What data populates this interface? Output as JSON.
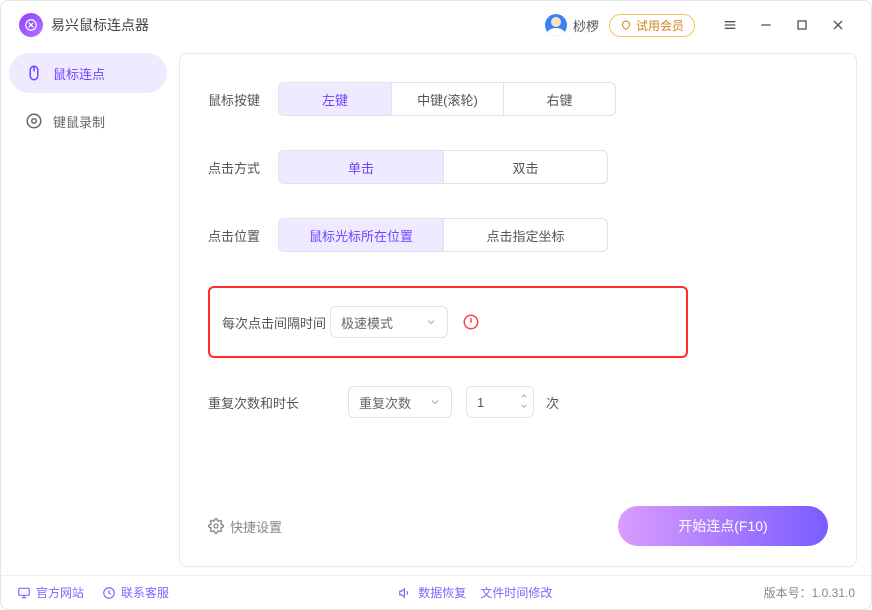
{
  "app": {
    "title": "易兴鼠标连点器"
  },
  "user": {
    "name": "桫椤",
    "badge": "试用会员"
  },
  "sidebar": {
    "items": [
      {
        "label": "鼠标连点"
      },
      {
        "label": "键鼠录制"
      }
    ]
  },
  "form": {
    "mouse_button": {
      "label": "鼠标按键",
      "options": [
        "左键",
        "中键(滚轮)",
        "右键"
      ]
    },
    "click_mode": {
      "label": "点击方式",
      "options": [
        "单击",
        "双击"
      ]
    },
    "click_position": {
      "label": "点击位置",
      "options": [
        "鼠标光标所在位置",
        "点击指定坐标"
      ]
    },
    "interval": {
      "label": "每次点击间隔时间",
      "selected": "极速模式"
    },
    "repeat": {
      "label": "重复次数和时长",
      "mode": "重复次数",
      "count": "1",
      "unit": "次"
    }
  },
  "footer": {
    "quickset": "快捷设置",
    "start": "开始连点(F10)"
  },
  "status": {
    "site": "官方网站",
    "service": "联系客服",
    "recover": "数据恢复",
    "filetime": "文件时间修改",
    "version_label": "版本号：",
    "version": "1.0.31.0"
  }
}
